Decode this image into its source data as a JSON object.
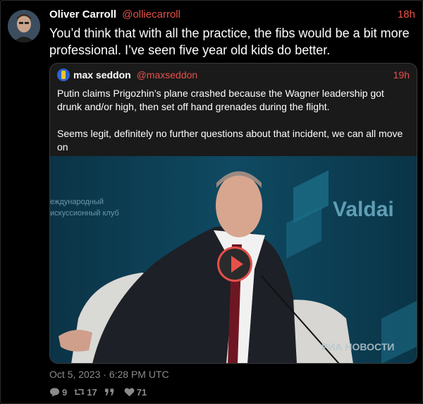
{
  "colors": {
    "background": "#000000",
    "accent": "#e6504a",
    "muted": "#8b8b8b",
    "quote_background": "#1a1a1a"
  },
  "tweet": {
    "author_name": "Oliver Carroll",
    "author_handle": "@olliecarroll",
    "time_ago": "18h",
    "text": "You’d think that with all the practice, the fibs would be a bit more professional. I’ve seen five year old kids do better.",
    "date": "Oct 5, 2023 · 6:28 PM UTC"
  },
  "quote": {
    "author_name": "max seddon",
    "author_handle": "@maxseddon",
    "time_ago": "19h",
    "paragraph_1": "Putin claims Prigozhin’s plane crashed because the Wagner leadership got drunk and/or high, then set off hand grenades during the flight.",
    "paragraph_2": "Seems legit, definitely no further questions about that incident, we can all move on",
    "video": {
      "backdrop_text_ru_1": "еждународный",
      "backdrop_text_ru_2": "искуссионный клуб",
      "backdrop_brand": "Valdai",
      "watermark": "РИА НОВОСТИ"
    }
  },
  "stats": {
    "replies": "9",
    "retweets": "17",
    "quotes": "",
    "likes": "71"
  },
  "icons": {
    "reply": "comment-icon",
    "retweet": "retweet-icon",
    "quote": "quote-icon",
    "like": "heart-icon",
    "play": "play-icon"
  }
}
